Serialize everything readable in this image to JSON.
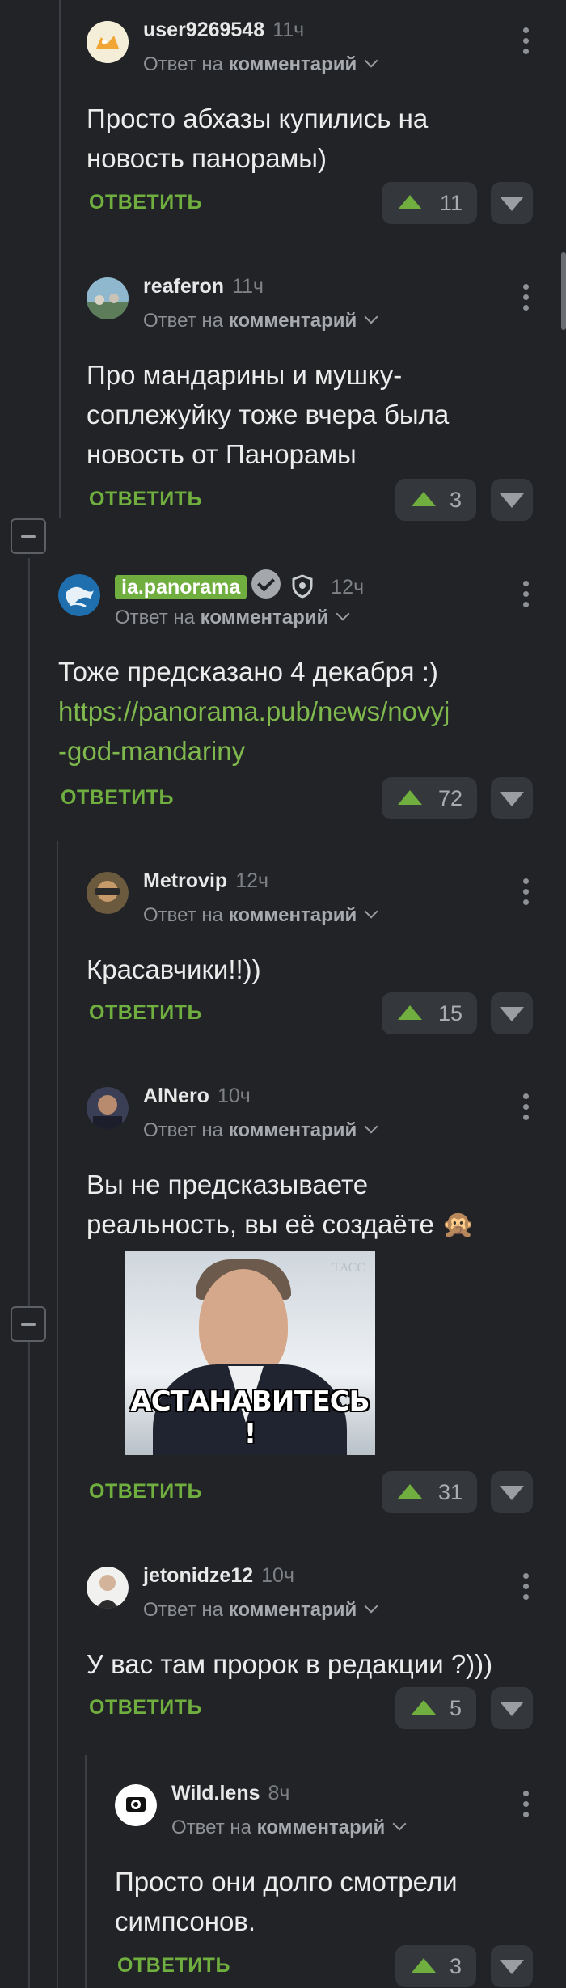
{
  "ui": {
    "reply_label": "ОТВЕТИТЬ",
    "reply_to_prefix": "Ответ на",
    "reply_to_target": "комментарий"
  },
  "comments": [
    {
      "author": "user9269548",
      "time": "11ч",
      "text": "Просто абхазы купились на новость панорамы)",
      "votes": "11"
    },
    {
      "author": "reaferon",
      "time": "11ч",
      "text": "Про мандарины и мушку-соплежуйку тоже вчера была новость от Панорамы",
      "votes": "3"
    },
    {
      "author": "ia.panorama",
      "time": "12ч",
      "text": "Тоже предсказано 4 декабря :)",
      "link": "https://panorama.pub/news/novyj-god-mandariny",
      "link_line1": "https://panorama.pub/news/novyj",
      "link_line2": "-god-mandariny",
      "votes": "72"
    },
    {
      "author": "Metrovip",
      "time": "12ч",
      "text": "Красавчики!!))",
      "votes": "15"
    },
    {
      "author": "AlNero",
      "time": "10ч",
      "text": "Вы не предсказываете реальность, вы её создаёте 🙊",
      "image_caption": "АСТАНАВИТЕСЬ !",
      "image_watermark": "ТАСС",
      "votes": "31"
    },
    {
      "author": "jetonidze12",
      "time": "10ч",
      "text": "У вас там пророк в редакции ?)))",
      "votes": "5"
    },
    {
      "author": "Wild.lens",
      "time": "8ч",
      "text": "Просто они долго смотрели симпсонов.",
      "votes": "3"
    }
  ],
  "colors": {
    "background": "#212326",
    "accent": "#6fae3f",
    "text": "#ececec",
    "muted": "#8e9195"
  },
  "icons": [
    "vertical-dots-icon",
    "chevron-down-icon",
    "arrow-up-icon",
    "arrow-down-icon",
    "collapse-minus-icon",
    "verified-check-icon",
    "shield-icon"
  ]
}
